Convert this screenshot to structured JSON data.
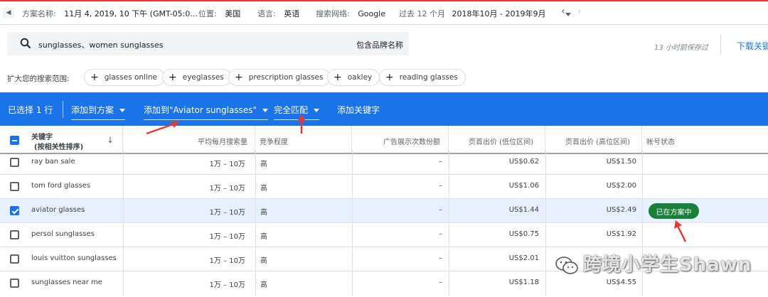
{
  "topbar": {
    "plan_name_label": "方案名称:",
    "plan_name_value": "11月 4, 2019, 10 下午 (GMT-05:0...",
    "location_label": "位置:",
    "location_value": "美国",
    "language_label": "语言:",
    "language_value": "英语",
    "network_label": "搜索网络:",
    "network_value": "Google",
    "period_label": "过去 12 个月",
    "period_value": "2018年10月 - 2019年9月"
  },
  "search": {
    "query": "sunglasses、women sunglasses",
    "brand_label": "包含品牌名称"
  },
  "saved_text": "13 小时前保存过",
  "download_label": "下载关键",
  "expand": {
    "label": "扩大您的搜索范围:",
    "chips": [
      "glasses online",
      "eyeglasses",
      "prescription glasses",
      "oakley",
      "reading glasses"
    ]
  },
  "actionbar": {
    "selected": "已选择 1 行",
    "add_to_plan": "添加到方案",
    "add_to_group": "添加到\"Aviator sunglasses\"",
    "match_type": "完全匹配",
    "add_keyword": "添加关键字"
  },
  "table": {
    "headers": {
      "keyword": "关键字",
      "keyword_sub": "(按相关性排序)",
      "avg_searches": "平均每月搜索量",
      "competition": "竞争程度",
      "impr_share": "广告展示次数份额",
      "bid_low": "页首出价 (低位区间)",
      "bid_high": "页首出价 (高位区间)",
      "status": "帐号状态"
    },
    "rows": [
      {
        "keyword": "ray ban sale",
        "searches": "1万 – 10万",
        "competition": "高",
        "share": "–",
        "low": "US$0.62",
        "high": "US$1.50",
        "status": "",
        "checked": false
      },
      {
        "keyword": "tom ford glasses",
        "searches": "1万 – 10万",
        "competition": "高",
        "share": "–",
        "low": "US$1.06",
        "high": "US$2.00",
        "status": "",
        "checked": false
      },
      {
        "keyword": "aviator glasses",
        "searches": "1万 – 10万",
        "competition": "高",
        "share": "–",
        "low": "US$1.44",
        "high": "US$2.49",
        "status": "已在方案中",
        "checked": true
      },
      {
        "keyword": "persol sunglasses",
        "searches": "1万 – 10万",
        "competition": "高",
        "share": "–",
        "low": "US$0.75",
        "high": "US$1.92",
        "status": "",
        "checked": false
      },
      {
        "keyword": "louis vuitton sunglasses",
        "searches": "1万 – 10万",
        "competition": "高",
        "share": "–",
        "low": "US$2.01",
        "high": "",
        "status": "",
        "checked": false
      },
      {
        "keyword": "sunglasses near me",
        "searches": "1万 – 10万",
        "competition": "高",
        "share": "–",
        "low": "US$1.18",
        "high": "US$4.55",
        "status": "",
        "checked": false
      }
    ]
  },
  "watermark": "跨境小学生Shawn",
  "colors": {
    "accent_blue": "#1a73e8",
    "status_green": "#188038",
    "annotation_red": "#e53935"
  }
}
